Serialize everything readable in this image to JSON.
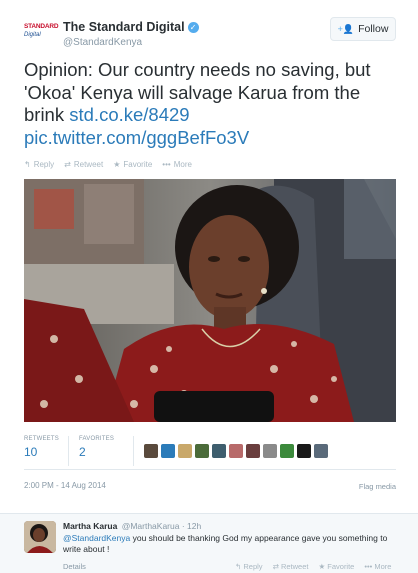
{
  "header": {
    "logo_line1": "STANDARD",
    "logo_line2": "Digital",
    "display_name": "The Standard Digital",
    "handle": "@StandardKenya",
    "follow_label": "Follow"
  },
  "tweet": {
    "text_main": "Opinion: Our country needs no saving, but 'Okoa' Kenya will salvage Karua from the brink ",
    "link1": "std.co.ke/8429",
    "link2": "pic.twitter.com/gggBefFo3V"
  },
  "actions": {
    "reply": "Reply",
    "retweet": "Retweet",
    "favorite": "Favorite",
    "more": "More"
  },
  "stats": {
    "retweets_label": "RETWEETS",
    "retweets_value": "10",
    "favorites_label": "FAVORITES",
    "favorites_value": "2"
  },
  "favoriter_colors": [
    "#5a4a3c",
    "#2b7bb9",
    "#c9a86a",
    "#4b6b3a",
    "#3e5e6e",
    "#b86a6a",
    "#6a3e3e",
    "#8a8a8a",
    "#3c8a3c",
    "#1a1a1a",
    "#5a6a7a"
  ],
  "meta": {
    "timestamp": "2:00 PM - 14 Aug 2014",
    "flag_media": "Flag media"
  },
  "reply": {
    "name": "Martha Karua",
    "handle": "@MarthaKarua",
    "time": "· 12h",
    "mention": "@StandardKenya",
    "text": " you should be thanking God my appearance gave you something to write about !",
    "details": "Details",
    "action_reply": "Reply",
    "action_retweet": "Retweet",
    "action_favorite": "Favorite",
    "action_more": "More"
  }
}
